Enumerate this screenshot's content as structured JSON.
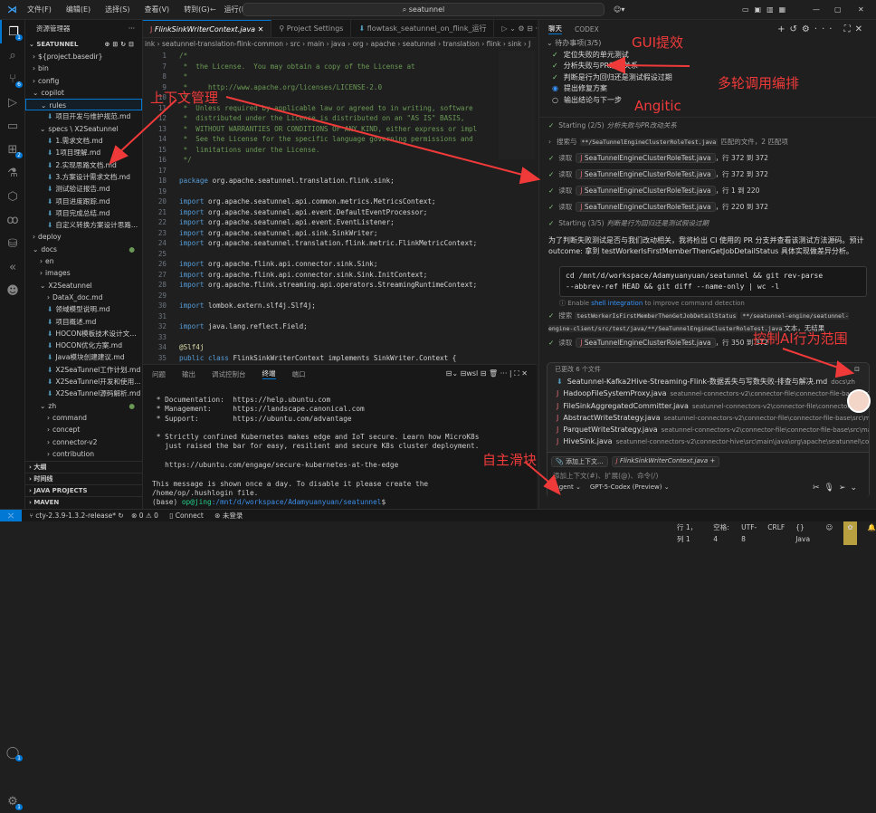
{
  "titlebar": {
    "menus": [
      "文件(F)",
      "编辑(E)",
      "选择(S)",
      "查看(V)",
      "转到(G)",
      "运行(R)",
      "···"
    ],
    "search": "seatunnel"
  },
  "activity": {
    "explorer_badge": "1",
    "scm_badge": "6",
    "ext_badge": "2",
    "account_badge": "1",
    "settings_badge": "1"
  },
  "sidebar": {
    "title": "资源管理器",
    "root": "SEATUNNEL",
    "items": [
      {
        "t": "${project.basedir}",
        "d": 1,
        "k": "folder",
        "o": false
      },
      {
        "t": "bin",
        "d": 1,
        "k": "folder",
        "o": false
      },
      {
        "t": "config",
        "d": 1,
        "k": "folder",
        "o": false
      },
      {
        "t": "copilot",
        "d": 1,
        "k": "folder",
        "o": true
      },
      {
        "t": "rules",
        "d": 2,
        "k": "folder",
        "o": true,
        "sel": true
      },
      {
        "t": "项目开发与维护规范.md",
        "d": 3,
        "k": "md"
      },
      {
        "t": "specs \\ X2Seatunnel",
        "d": 2,
        "k": "folder",
        "o": true
      },
      {
        "t": "1.需求文档.md",
        "d": 3,
        "k": "md"
      },
      {
        "t": "1项目理解.md",
        "d": 3,
        "k": "md"
      },
      {
        "t": "2.实现思路文档.md",
        "d": 3,
        "k": "md"
      },
      {
        "t": "3.方案设计需求文档.md",
        "d": 3,
        "k": "md"
      },
      {
        "t": "测试验证报告.md",
        "d": 3,
        "k": "md"
      },
      {
        "t": "项目进度跟踪.md",
        "d": 3,
        "k": "md"
      },
      {
        "t": "项目完成总结.md",
        "d": 3,
        "k": "md"
      },
      {
        "t": "自定义转换方案设计思路...",
        "d": 3,
        "k": "md"
      },
      {
        "t": "deploy",
        "d": 1,
        "k": "folder",
        "o": false
      },
      {
        "t": "docs",
        "d": 1,
        "k": "folder",
        "o": true,
        "mod": true
      },
      {
        "t": "en",
        "d": 2,
        "k": "folder",
        "o": false
      },
      {
        "t": "images",
        "d": 2,
        "k": "folder",
        "o": false
      },
      {
        "t": "X2Seatunnel",
        "d": 2,
        "k": "folder",
        "o": true
      },
      {
        "t": "DataX_doc.md",
        "d": 3,
        "k": "folder",
        "o": false
      },
      {
        "t": "领域模型说明.md",
        "d": 3,
        "k": "md"
      },
      {
        "t": "项目概述.md",
        "d": 3,
        "k": "md"
      },
      {
        "t": "HOCON模板技术设计文档...",
        "d": 3,
        "k": "md"
      },
      {
        "t": "HOCON优化方案.md",
        "d": 3,
        "k": "md"
      },
      {
        "t": "Java模块创建建议.md",
        "d": 3,
        "k": "md"
      },
      {
        "t": "X2SeaTunnel工作计划.md",
        "d": 3,
        "k": "md"
      },
      {
        "t": "X2SeaTunnel开发和使用...",
        "d": 3,
        "k": "md"
      },
      {
        "t": "X2SeaTunnel源码解析.md",
        "d": 3,
        "k": "md"
      },
      {
        "t": "zh",
        "d": 2,
        "k": "folder",
        "o": true,
        "mod": true
      },
      {
        "t": "command",
        "d": 3,
        "k": "folder",
        "o": false
      },
      {
        "t": "concept",
        "d": 3,
        "k": "folder",
        "o": false
      },
      {
        "t": "connector-v2",
        "d": 3,
        "k": "folder",
        "o": false
      },
      {
        "t": "contribution",
        "d": 3,
        "k": "folder",
        "o": false
      }
    ],
    "sections": [
      "大纲",
      "时间线",
      "JAVA PROJECTS",
      "MAVEN"
    ]
  },
  "editor": {
    "tabs": [
      "FlinkSinkWriterContext.java",
      "Project Settings",
      "flowtask_seatunnel_on_flink_运行"
    ],
    "breadcrumb": "ink › seatunnel-translation-flink-common › src › main › java › org › apache › seatunnel › translation › flink › sink › J",
    "lines": [
      [
        "1",
        "/*"
      ],
      [
        "7",
        " *  the License.  You may obtain a copy of the License at"
      ],
      [
        "8",
        " *"
      ],
      [
        "9",
        " *     http://www.apache.org/licenses/LICENSE-2.0"
      ],
      [
        "10",
        " *"
      ],
      [
        "11",
        " *  Unless required by applicable law or agreed to in writing, software"
      ],
      [
        "12",
        " *  distributed under the License is distributed on an \"AS IS\" BASIS,"
      ],
      [
        "13",
        " *  WITHOUT WARRANTIES OR CONDITIONS OF ANY KIND, either express or impl"
      ],
      [
        "14",
        " *  See the License for the specific language governing permissions and"
      ],
      [
        "15",
        " *  limitations under the License."
      ],
      [
        "16",
        " */"
      ],
      [
        "17",
        ""
      ],
      [
        "18",
        "package org.apache.seatunnel.translation.flink.sink;"
      ],
      [
        "19",
        ""
      ],
      [
        "20",
        "import org.apache.seatunnel.api.common.metrics.MetricsContext;"
      ],
      [
        "21",
        "import org.apache.seatunnel.api.event.DefaultEventProcessor;"
      ],
      [
        "22",
        "import org.apache.seatunnel.api.event.EventListener;"
      ],
      [
        "23",
        "import org.apache.seatunnel.api.sink.SinkWriter;"
      ],
      [
        "24",
        "import org.apache.seatunnel.translation.flink.metric.FlinkMetricContext;"
      ],
      [
        "25",
        ""
      ],
      [
        "26",
        "import org.apache.flink.api.connector.sink.Sink;"
      ],
      [
        "27",
        "import org.apache.flink.api.connector.sink.Sink.InitContext;"
      ],
      [
        "28",
        "import org.apache.flink.streaming.api.operators.StreamingRuntimeContext;"
      ],
      [
        "29",
        ""
      ],
      [
        "30",
        "import lombok.extern.slf4j.Slf4j;"
      ],
      [
        "31",
        ""
      ],
      [
        "32",
        "import java.lang.reflect.Field;"
      ],
      [
        "33",
        ""
      ],
      [
        "34",
        "@Slf4j"
      ],
      [
        "35",
        "public class FlinkSinkWriterContext implements SinkWriter.Context {"
      ]
    ]
  },
  "panel": {
    "tabs": [
      "问题",
      "输出",
      "调试控制台",
      "终端",
      "端口"
    ],
    "active": 3,
    "shell": "wsl",
    "lines": [
      " * Documentation:  https://help.ubuntu.com",
      " * Management:     https://landscape.canonical.com",
      " * Support:        https://ubuntu.com/advantage",
      "",
      " * Strictly confined Kubernetes makes edge and IoT secure. Learn how MicroK8s",
      "   just raised the bar for easy, resilient and secure K8s cluster deployment.",
      "",
      "   https://ubuntu.com/engage/secure-kubernetes-at-the-edge",
      "",
      "This message is shown once a day. To disable it please create the",
      "/home/op/.hushlogin file."
    ],
    "prompt_env": "(base) ",
    "prompt_user": "op@jing",
    "prompt_path": ":/mnt/d/workspace/Adamyuanyuan/seatunnel",
    "prompt_end": "$"
  },
  "chat": {
    "tabs": [
      "聊天",
      "CODEX"
    ],
    "todo_title": "待办事项(3/5)",
    "todos": [
      {
        "t": "定位失败的单元测试",
        "s": "done"
      },
      {
        "t": "分析失败与PR改动关系",
        "s": "done"
      },
      {
        "t": "判断是行为回归还是测试假设过期",
        "s": "done"
      },
      {
        "t": "提出修复方案",
        "s": "active"
      },
      {
        "t": "输出结论与下一步",
        "s": "pending"
      }
    ],
    "step2": "Starting (2/5)",
    "step2_name": "分析失败与PR改动关系",
    "search1_pre": "搜索与",
    "search1_pat": "**/SeaTunnelEngineClusterRoleTest.java",
    "search1_post": "匹配的文件，2 匹配项",
    "reads": [
      {
        "f": "SeaTunnelEngineClusterRoleTest.java",
        "r": "，行 372 到 372"
      },
      {
        "f": "SeaTunnelEngineClusterRoleTest.java",
        "r": "，行 372 到 372"
      },
      {
        "f": "SeaTunnelEngineClusterRoleTest.java",
        "r": "，行 1 到 220"
      },
      {
        "f": "SeaTunnelEngineClusterRoleTest.java",
        "r": "，行 220 到 372"
      }
    ],
    "read_label": "读取",
    "step3": "Starting (3/5)",
    "step3_name": "判断是行为回归还是测试假设过期",
    "message": "为了判断失败测试是否与我们改动相关，我将检出 CI 使用的 PR 分支并查看该测试方法源码。预计 outcome: 拿到 testWorkerIsFirstMemberThenGetJobDetailStatus 具体实现做差异分析。",
    "cmd1": "cd /mnt/d/workspace/Adamyuanyuan/seatunnel && git rev-parse",
    "cmd2": "--abbrev-ref HEAD && git diff --name-only | wc -l",
    "shell_hint_pre": "ⓘ Enable ",
    "shell_hint_link": "shell integration",
    "shell_hint_post": " to improve command detection",
    "search2_pre": "搜索",
    "search2_sym": "testWorkerIsFirstMemberThenGetJobDetailStatus",
    "search2_pat": "**/seatunnel-engine/seatunnel-engine-client/src/test/java/**/SeaTunnelEngineClusterRoleTest.java",
    "search2_post": "文本，无结果",
    "read5": {
      "f": "SeaTunnelEngineClusterRoleTest.java",
      "r": "，行 350 到 372"
    },
    "changed_title": "已更改 6 个文件",
    "files": [
      {
        "n": "Seatunnel-Kafka2Hive-Streaming-Flink-数据丢失与写数失败-排查与解决.md",
        "p": "docs\\zh",
        "k": "md"
      },
      {
        "n": "HadoopFileSystemProxy.java",
        "p": "seatunnel-connectors-v2\\connector-file\\connector-file-base\\src\\main",
        "k": "java"
      },
      {
        "n": "FileSinkAggregatedCommitter.java",
        "p": "seatunnel-connectors-v2\\connector-file\\connector-file-base\\src\\",
        "k": "java"
      },
      {
        "n": "AbstractWriteStrategy.java",
        "p": "seatunnel-connectors-v2\\connector-file\\connector-file-base\\src\\main\\jav...",
        "k": "java"
      },
      {
        "n": "ParquetWriteStrategy.java",
        "p": "seatunnel-connectors-v2\\connector-file\\connector-file-base\\src\\main\\jav...",
        "k": "java"
      },
      {
        "n": "HiveSink.java",
        "p": "seatunnel-connectors-v2\\connector-hive\\src\\main\\java\\org\\apache\\seatunnel\\connecto...",
        "k": "java"
      }
    ],
    "add_context": "添加上下文...",
    "context_file": "FlinkSinkWriterContext.java",
    "input_placeholder": "添加上下文(#)、扩展(@)、命令(/)",
    "mode": "Agent",
    "model": "GPT-5-Codex (Preview)"
  },
  "status": {
    "branch": "cty-2.3.9-1.3.2-release*",
    "errors": "0",
    "warnings": "0",
    "connect": "Connect",
    "login": "未登录",
    "position": "行 1，列 1",
    "spaces": "空格: 4",
    "encoding": "UTF-8",
    "eol": "CRLF",
    "lang": "{} Java"
  },
  "annotations": {
    "gui": "GUI提效",
    "multi": "多轮调用编排",
    "agentic": "Angitic",
    "context": "上下文管理",
    "scope": "控制AI行为范围",
    "slider": "自主滑块"
  },
  "colors": {
    "accent": "#0078d4",
    "annotation": "#f03a3a",
    "check": "#89d185"
  }
}
